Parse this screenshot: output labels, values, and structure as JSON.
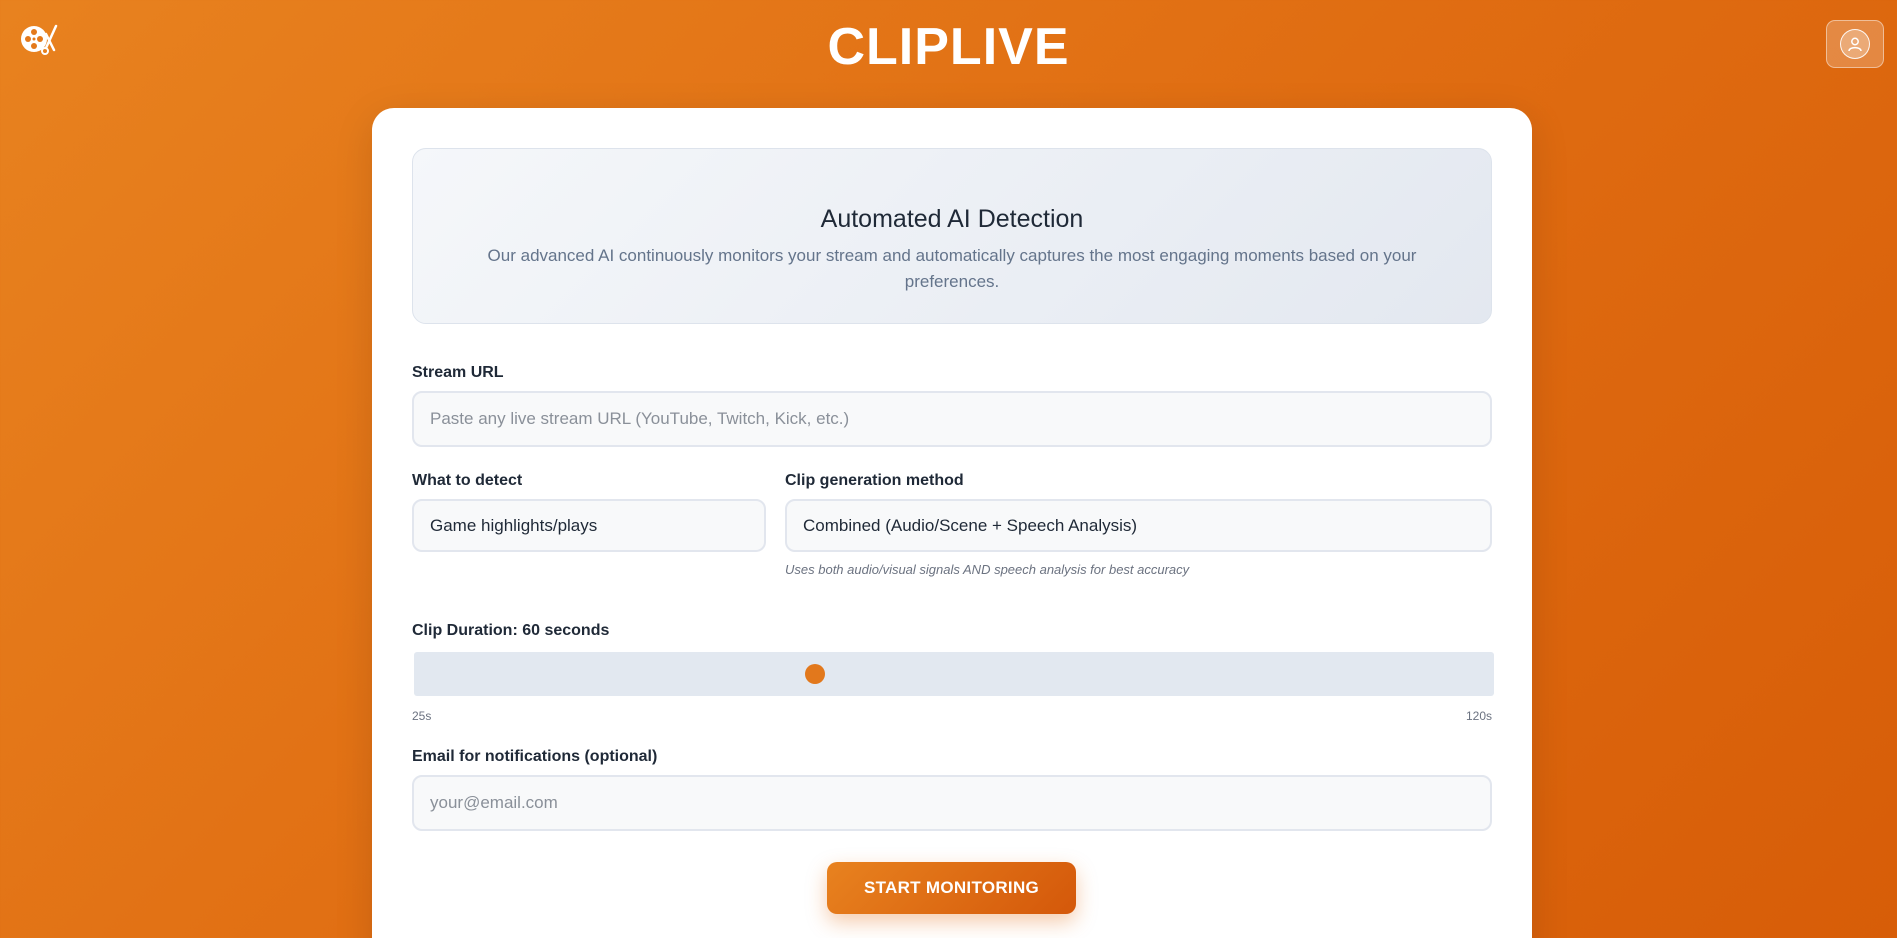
{
  "header": {
    "logo_icon": "film-reel-scissors-icon",
    "title": "CLIPLIVE",
    "profile_icon": "user-icon"
  },
  "info": {
    "title": "Automated AI Detection",
    "description": "Our advanced AI continuously monitors your stream and automatically captures the most engaging moments based on your preferences."
  },
  "form": {
    "stream_url": {
      "label": "Stream URL",
      "placeholder": "Paste any live stream URL (YouTube, Twitch, Kick, etc.)",
      "value": ""
    },
    "detect": {
      "label": "What to detect",
      "value": "Game highlights/plays"
    },
    "method": {
      "label": "Clip generation method",
      "value": "Combined (Audio/Scene + Speech Analysis)",
      "hint": "Uses both audio/visual signals AND speech analysis for best accuracy"
    },
    "duration": {
      "label": "Clip Duration: 60 seconds",
      "min_label": "25s",
      "max_label": "120s",
      "min": 25,
      "max": 120,
      "value": 60
    },
    "email": {
      "label": "Email for notifications (optional)",
      "placeholder": "your@email.com",
      "value": ""
    },
    "submit_label": "START MONITORING"
  },
  "colors": {
    "accent": "#e2781c",
    "background_start": "#e8821f",
    "background_end": "#d75d08"
  }
}
